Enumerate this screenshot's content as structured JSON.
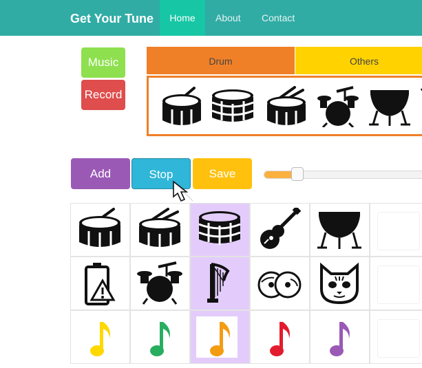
{
  "navbar": {
    "brand": "Get Your Tune",
    "links": [
      {
        "label": "Home",
        "active": true
      },
      {
        "label": "About",
        "active": false
      },
      {
        "label": "Contact",
        "active": false
      }
    ]
  },
  "side_buttons": {
    "music": "Music",
    "record": "Record"
  },
  "tabs": [
    {
      "label": "Drum",
      "color": "#f08027"
    },
    {
      "label": "Others",
      "color": "#ffd200"
    }
  ],
  "palette_icons": [
    "snare-drum-icon",
    "bass-drum-icon",
    "snare-drum-sticks-icon",
    "drum-kit-icon",
    "timpani-icon"
  ],
  "actions": {
    "add": "Add",
    "stop": "Stop",
    "save": "Save"
  },
  "colors": {
    "navbar": "#30aca5",
    "nav_active": "#17c6a5",
    "music": "#8ee04f",
    "record": "#df4d4d",
    "add": "#9b59b6",
    "stop": "#2fb6d9",
    "save": "#ffc10e",
    "highlight": "#e3ccfb"
  },
  "volume_slider": {
    "value_fraction": 0.2
  },
  "sound_grid": {
    "rows": [
      [
        "snare-drum-icon",
        "snare-drum-sticks-icon",
        "bass-drum-icon",
        "guitar-icon",
        "timpani-icon",
        "empty"
      ],
      [
        "low-battery-warning-icon",
        "drum-kit-icon",
        "harp-icon",
        "cymbals-icon",
        "cat-icon",
        "empty"
      ],
      [
        "yellow-note-icon",
        "green-note-icon",
        "orange-note-icon",
        "red-note-icon",
        "purple-note-icon",
        "empty"
      ]
    ],
    "highlighted_column": 2
  }
}
